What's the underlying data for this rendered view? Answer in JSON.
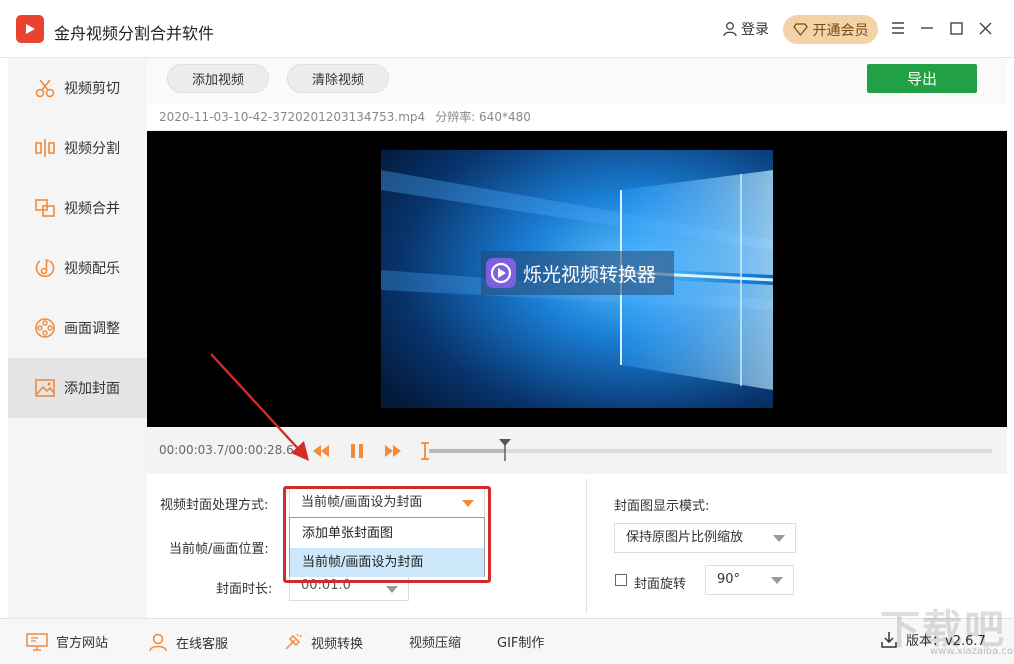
{
  "app": {
    "title": "金舟视频分割合并软件"
  },
  "header": {
    "login_label": "登录",
    "vip_label": "开通会员"
  },
  "sidebar": {
    "items": [
      {
        "label": "视频剪切",
        "icon": "scissors-icon"
      },
      {
        "label": "视频分割",
        "icon": "split-icon"
      },
      {
        "label": "视频合并",
        "icon": "merge-icon"
      },
      {
        "label": "视频配乐",
        "icon": "music-icon"
      },
      {
        "label": "画面调整",
        "icon": "film-reel-icon"
      },
      {
        "label": "添加封面",
        "icon": "image-icon"
      }
    ],
    "active_index": 5
  },
  "toolbar": {
    "add_video_label": "添加视频",
    "clear_video_label": "清除视频",
    "export_label": "导出"
  },
  "file": {
    "name": "2020-11-03-10-42-3720201203134753.mp4",
    "resolution": "分辨率: 640*480"
  },
  "preview": {
    "watermark_text": "烁光视频转换器"
  },
  "playback": {
    "time_display": "00:00:03.7/00:00:28.6",
    "progress_fraction": 0.135
  },
  "cover_settings": {
    "mode_label": "视频封面处理方式:",
    "mode_value": "当前帧/画面设为封面",
    "mode_options": [
      "添加单张封面图",
      "当前帧/画面设为封面"
    ],
    "mode_selected_index": 1,
    "position_label": "当前帧/画面位置:",
    "duration_label": "封面时长:",
    "duration_value": "00:01.0",
    "display_mode_label": "封面图显示模式:",
    "display_mode_value": "保持原图片比例缩放",
    "rotate_label": "封面旋转",
    "rotate_checked": false,
    "rotate_value": "90°"
  },
  "statusbar": {
    "website_label": "官方网站",
    "service_label": "在线客服",
    "convert_label": "视频转换",
    "compress_label": "视频压缩",
    "gif_label": "GIF制作",
    "version_label": "版本：v2.6.7"
  },
  "colors": {
    "accent_orange": "#f08a3c",
    "export_green": "#21a046",
    "highlight_red": "#d42a2a"
  },
  "site_watermark": {
    "text": "下载吧",
    "url": "www.xiazaiba.com"
  }
}
